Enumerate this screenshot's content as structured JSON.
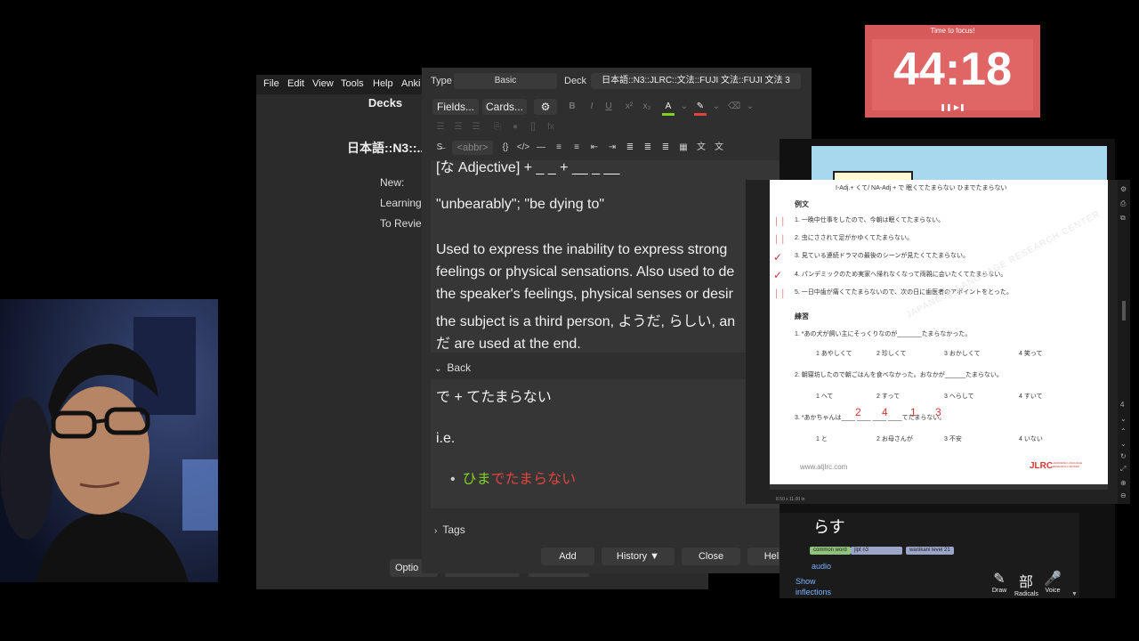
{
  "anki_main": {
    "menu": [
      "File",
      "Edit",
      "View",
      "Tools",
      "Help",
      "Anki"
    ],
    "title": "Decks",
    "deck_name": "日本語::N3::..",
    "stats": [
      "New:",
      "Learning",
      "To Revie"
    ],
    "options_label": "Optio"
  },
  "add_dialog": {
    "type_label": "Type",
    "type_value": "Basic",
    "deck_label": "Deck",
    "deck_value": "日本語::N3::JLRC::文法::FUJI 文法::FUJI 文法 3",
    "fields_btn": "Fields...",
    "cards_btn": "Cards...",
    "gear_icon": "⚙",
    "abbr_label": "<abbr>",
    "front_lines": [
      "[な Adjective] + _ _ + __ _ __",
      "\"unbearably\"; \"be dying to\"",
      "Used to express the inability to express strong",
      "feelings or physical sensations. Also used to de",
      "the speaker's feelings, physical senses or desir",
      "the subject is a third person, ようだ, らしい, an",
      "だ are used at the end."
    ],
    "back_label": "Back",
    "back_lines": [
      "で + てたまらない",
      "i.e."
    ],
    "back_example_green": "ひま",
    "back_example_red": "でたまらない",
    "tags_label": "Tags",
    "buttons": {
      "add": "Add",
      "history": "History ▼",
      "close": "Close",
      "help": "Help"
    }
  },
  "timer": {
    "label": "Time to focus!",
    "value": "44:18",
    "controls": "❚❚ ▶❚"
  },
  "pdf": {
    "header": "I-Adj.+  くて/ NA-Adj + で      眠くてたまらない        ひまでたまらない",
    "section_examples": "例文",
    "examples": [
      "1. 一晩中仕事をしたので、今朝は眠くてたまらない。",
      "2. 虫にさされて足がかゆくてたまらない。",
      "3. 見ている連続ドラマの最後のシーンが見たくてたまらない。",
      "4. パンデミックのため実家へ帰れなくなって両親に会いたくてたまらない。",
      "5. 一日中歯が痛くてたまらないので、次の日に歯医者のアポイントをとった。"
    ],
    "section_practice": "練習",
    "q1": "1. *あの犬が飼い主にそっくりなのが_______たまらなかった。",
    "q1_choices": [
      "1 あやしくて",
      "2 珍しくて",
      "3 おかしくて",
      "4 笑って"
    ],
    "q2": "2. 朝寝坊したので朝ごはんを食べなかった。おなかが______たまらない。",
    "q2_choices": [
      "1 へて",
      "2 すって",
      "3 へらして",
      "4 すいて"
    ],
    "q3": "3. *あかちゃんは____ ____ ____ ____てたまらない。",
    "q3_answers": [
      "2",
      "4",
      "1",
      "3"
    ],
    "q3_choices": [
      "1 と",
      "2 お母さんが",
      "3 不安",
      "4 いない"
    ],
    "url": "www.atjlrc.com",
    "logo": "JLRC",
    "logo_sub": "JAPANESE LANGUAGE RESEARCH CENTER",
    "watermark": "JAPANESE LANGUAGE RESEARCH CENTER",
    "footer": "8.50 x 11.00 in"
  },
  "dictionary": {
    "word": "らす",
    "tags": [
      "common word",
      "jlpt n3",
      "wanikani level 21"
    ],
    "audio": "audio",
    "show": "Show",
    "inflections": "inflections",
    "tools": [
      {
        "icon": "✎",
        "label": "Draw"
      },
      {
        "icon": "部",
        "label": "Radicals"
      },
      {
        "icon": "🎤",
        "label": "Voice"
      }
    ]
  },
  "colors": {
    "timer_bg": "#d65a5a",
    "green_text": "#7ed321",
    "red_text": "#e0443c"
  }
}
